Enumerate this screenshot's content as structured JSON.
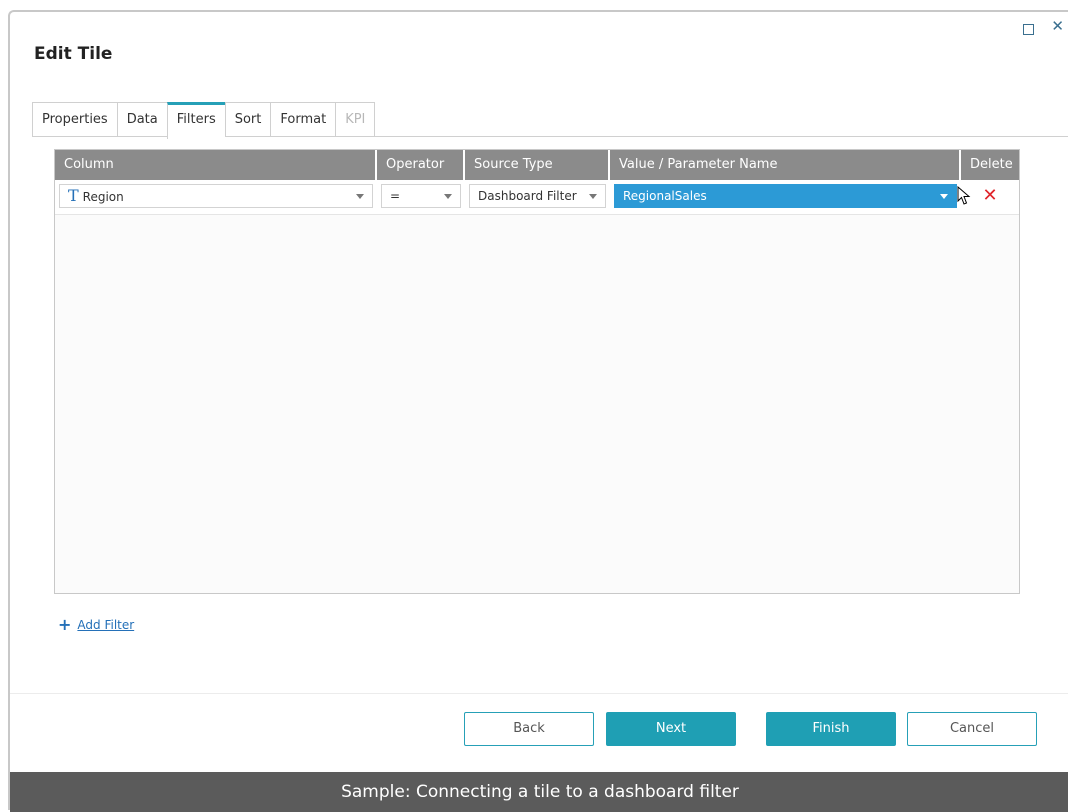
{
  "dialog": {
    "title": "Edit Tile"
  },
  "window_controls": {
    "maximize": "☐",
    "close": "✕"
  },
  "tabs": [
    {
      "label": "Properties",
      "state": "normal"
    },
    {
      "label": "Data",
      "state": "normal"
    },
    {
      "label": "Filters",
      "state": "active"
    },
    {
      "label": "Sort",
      "state": "normal"
    },
    {
      "label": "Format",
      "state": "normal"
    },
    {
      "label": "KPI",
      "state": "disabled"
    }
  ],
  "grid": {
    "headers": {
      "column": "Column",
      "operator": "Operator",
      "source_type": "Source Type",
      "value": "Value / Parameter Name",
      "delete": "Delete"
    },
    "rows": [
      {
        "column_icon": "T",
        "column": "Region",
        "operator": "=",
        "source_type": "Dashboard Filter",
        "value": "RegionalSales",
        "delete": "✕"
      }
    ]
  },
  "add_filter": {
    "label": "Add Filter",
    "icon": "+"
  },
  "buttons": {
    "back": "Back",
    "next": "Next",
    "finish": "Finish",
    "cancel": "Cancel"
  },
  "caption": "Sample: Connecting a tile to a dashboard filter",
  "colors": {
    "accent": "#1f9fb4",
    "selected": "#2c9ad6",
    "delete": "#e0242a",
    "header": "#8b8b8b"
  }
}
